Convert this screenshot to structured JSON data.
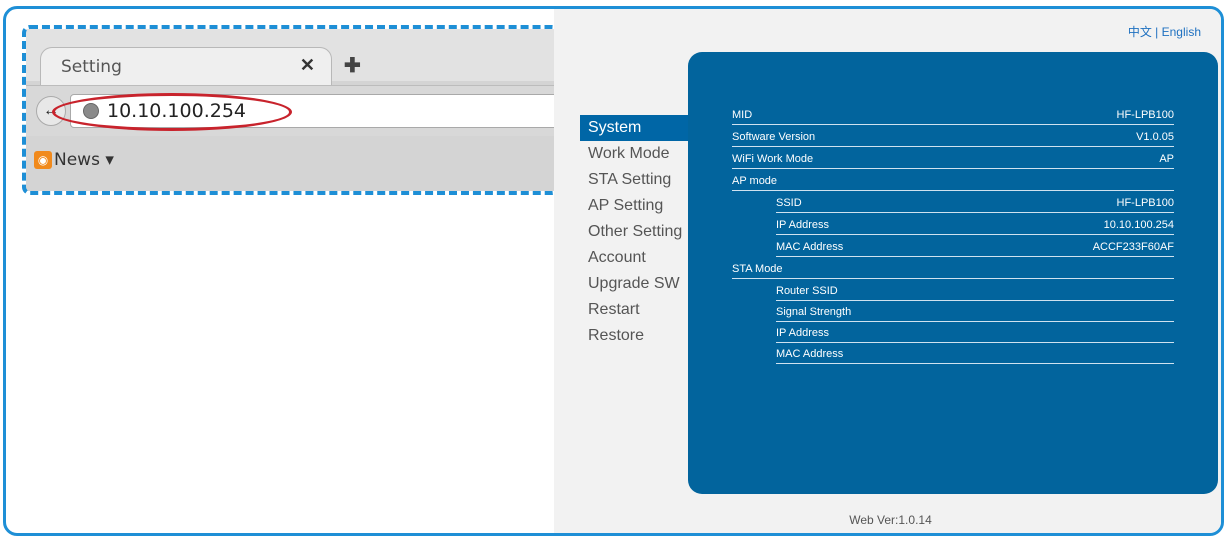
{
  "browser": {
    "tab_title": "Setting",
    "tab_close_glyph": "✕",
    "new_tab_glyph": "✚",
    "back_glyph": "←",
    "url": "10.10.100.254",
    "bookmark": "News ▾",
    "icons": [
      "globe-icon",
      "rss-icon",
      "back-icon",
      "close-icon",
      "plus-icon"
    ]
  },
  "webpage": {
    "lang_links": "中文 | English",
    "nav": [
      "System",
      "Work Mode",
      "STA Setting",
      "AP Setting",
      "Other Setting",
      "Account",
      "Upgrade SW",
      "Restart",
      "Restore"
    ],
    "nav_active": "System",
    "rows": [
      {
        "label": "MID",
        "value": "HF-LPB100"
      },
      {
        "label": "Software Version",
        "value": "V1.0.05"
      },
      {
        "label": "WiFi Work Mode",
        "value": "AP"
      },
      {
        "label": "AP mode",
        "value": ""
      },
      {
        "label": "SSID",
        "value": "HF-LPB100"
      },
      {
        "label": "IP Address",
        "value": "10.10.100.254"
      },
      {
        "label": "MAC Address",
        "value": "ACCF233F60AF"
      },
      {
        "label": "STA Mode",
        "value": ""
      },
      {
        "label": "Router SSID",
        "value": ""
      },
      {
        "label": "Signal Strength",
        "value": ""
      },
      {
        "label": "IP Address",
        "value": ""
      },
      {
        "label": "MAC Address",
        "value": ""
      }
    ],
    "web_version": "Web Ver:1.0.14",
    "colors": {
      "panel": "#02649d",
      "nav_active": "#0066a6",
      "frame": "#1e8fd6",
      "highlight": "#c8232c"
    }
  }
}
